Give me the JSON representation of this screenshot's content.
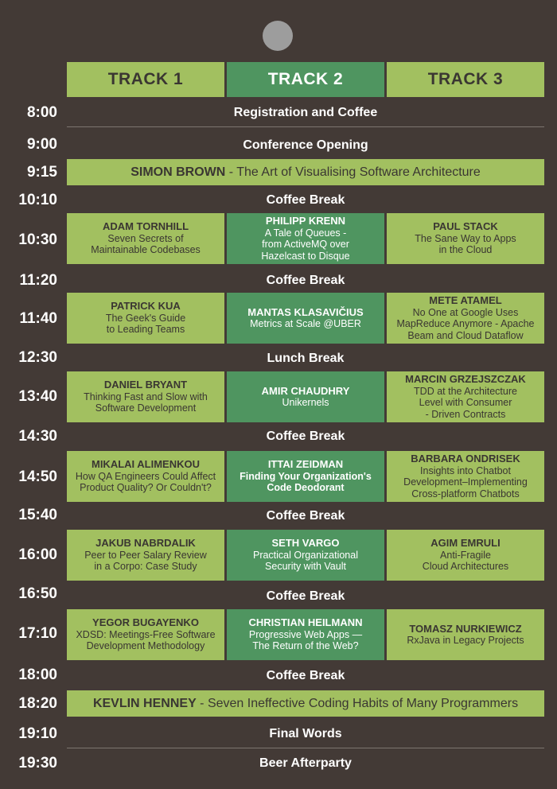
{
  "tracks": [
    "TRACK 1",
    "TRACK 2",
    "TRACK 3"
  ],
  "times": {
    "t800": "8:00",
    "t900": "9:00",
    "t915": "9:15",
    "t1010": "10:10",
    "t1030": "10:30",
    "t1120": "11:20",
    "t1140": "11:40",
    "t1230": "12:30",
    "t1340": "13:40",
    "t1430": "14:30",
    "t1450": "14:50",
    "t1540": "15:40",
    "t1600": "16:00",
    "t1650": "16:50",
    "t1710": "17:10",
    "t1800": "18:00",
    "t1820": "18:20",
    "t1910": "19:10",
    "t1930": "19:30"
  },
  "events": {
    "registration": "Registration and Coffee",
    "opening": "Conference Opening",
    "coffee": "Coffee Break",
    "lunch": "Lunch Break",
    "final": "Final Words",
    "beer": "Beer Afterparty"
  },
  "keynotes": {
    "k1": {
      "speaker": "SIMON BROWN",
      "title": " - The Art of Visualising Software Architecture"
    },
    "k2": {
      "speaker": "KEVLIN HENNEY",
      "title": " - Seven Ineffective Coding Habits of Many Programmers"
    }
  },
  "sessions": {
    "s1030": [
      {
        "speaker": "ADAM TORNHILL",
        "l1": "Seven Secrets of",
        "l2": "Maintainable Codebases",
        "l3": ""
      },
      {
        "speaker": "PHILIPP KRENN",
        "l1": "A Tale of Queues -",
        "l2": "from ActiveMQ over",
        "l3": "Hazelcast to Disque"
      },
      {
        "speaker": "PAUL STACK",
        "l1": "The Sane Way to Apps",
        "l2": "in the Cloud",
        "l3": ""
      }
    ],
    "s1140": [
      {
        "speaker": "PATRICK KUA",
        "l1": "The Geek's Guide",
        "l2": "to Leading Teams",
        "l3": ""
      },
      {
        "speaker": "MANTAS KLASAVIČIUS",
        "l1": "Metrics at Scale @UBER",
        "l2": "",
        "l3": ""
      },
      {
        "speaker": "METE ATAMEL",
        "l1": "No One at Google Uses",
        "l2": "MapReduce Anymore - Apache",
        "l3": "Beam and Cloud Dataflow"
      }
    ],
    "s1340": [
      {
        "speaker": "DANIEL BRYANT",
        "l1": "Thinking Fast and Slow with",
        "l2": "Software Development",
        "l3": ""
      },
      {
        "speaker": "AMIR CHAUDHRY",
        "l1": "Unikernels",
        "l2": "",
        "l3": ""
      },
      {
        "speaker": "MARCIN GRZEJSZCZAK",
        "l1": "TDD at the Architecture",
        "l2": "Level with Consumer",
        "l3": "- Driven Contracts"
      }
    ],
    "s1450": [
      {
        "speaker": "MIKALAI ALIMENKOU",
        "l1": "How QA Engineers Could Affect",
        "l2": "Product Quality? Or Couldn't?",
        "l3": ""
      },
      {
        "speaker": "ITTAI ZEIDMAN",
        "l1": "Finding Your Organization's",
        "l2": "Code Deodorant",
        "l3": ""
      },
      {
        "speaker": "BARBARA ONDRISEK",
        "l1": "Insights into Chatbot",
        "l2": "Development–Implementing",
        "l3": "Cross-platform Chatbots"
      }
    ],
    "s1600": [
      {
        "speaker": "JAKUB NABRDALIK",
        "l1": "Peer to Peer Salary Review",
        "l2": "in a Corpo: Case Study",
        "l3": ""
      },
      {
        "speaker": "SETH VARGO",
        "l1": "Practical Organizational",
        "l2": "Security with Vault",
        "l3": ""
      },
      {
        "speaker": "AGIM EMRULI",
        "l1": "Anti-Fragile",
        "l2": "Cloud Architectures",
        "l3": ""
      }
    ],
    "s1710": [
      {
        "speaker": "YEGOR BUGAYENKO",
        "l1": "XDSD: Meetings-Free Software",
        "l2": "Development Methodology",
        "l3": ""
      },
      {
        "speaker": "CHRISTIAN HEILMANN",
        "l1": "Progressive Web Apps —",
        "l2": "The Return of the Web?",
        "l3": ""
      },
      {
        "speaker": "TOMASZ NURKIEWICZ",
        "l1": "RxJava in Legacy Projects",
        "l2": "",
        "l3": ""
      }
    ]
  }
}
